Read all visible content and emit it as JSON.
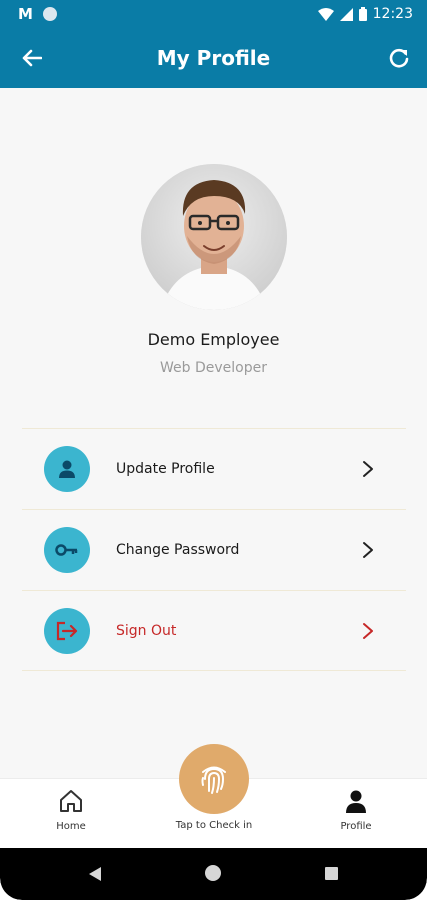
{
  "status_bar": {
    "time": "12:23"
  },
  "app_bar": {
    "title": "My Profile"
  },
  "profile": {
    "name": "Demo Employee",
    "role": "Web Developer"
  },
  "menu": [
    {
      "label": "Update Profile",
      "icon": "person-icon"
    },
    {
      "label": "Change Password",
      "icon": "key-icon"
    },
    {
      "label": "Sign Out",
      "icon": "logout-icon"
    }
  ],
  "bottom_nav": {
    "home_label": "Home",
    "checkin_label": "Tap to Check in",
    "profile_label": "Profile"
  },
  "colors": {
    "primary": "#0a7ca6",
    "menu_icon_bg": "#3bb5cf",
    "checkin_bg": "#e0aa6b",
    "danger": "#c62828"
  }
}
